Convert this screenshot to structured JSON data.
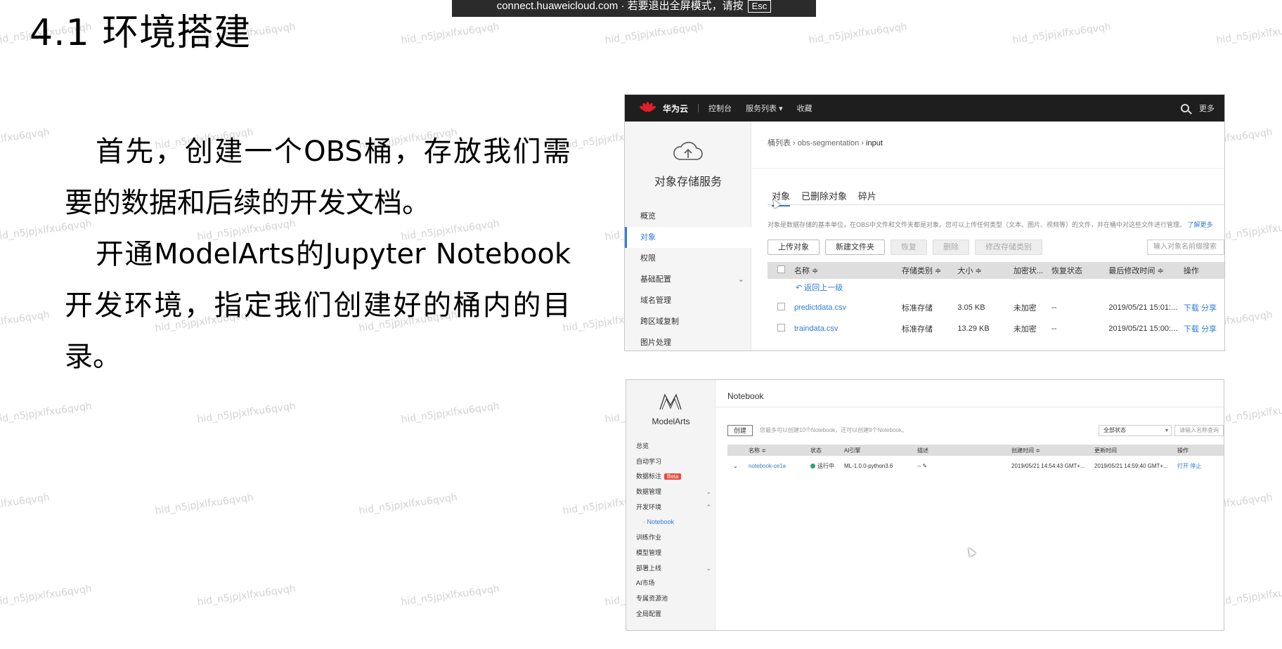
{
  "toast": {
    "text": "connect.huaweicloud.com · 若要退出全屏模式，请按",
    "key": "Esc"
  },
  "slide": {
    "title": "4.1 环境搭建",
    "paragraphs": [
      "首先，创建一个OBS桶，存放我们需要的数据和后续的开发文档。",
      "开通ModelArts的Jupyter Notebook开发环境，指定我们创建好的桶内的目录。"
    ]
  },
  "watermark": "hid_n5jpjxlfxu6qvqh",
  "obs": {
    "topbar": {
      "brand": "华为云",
      "nav": [
        "控制台",
        "服务列表 ▾",
        "收藏"
      ],
      "more": "更多"
    },
    "sidebar": {
      "service": "对象存储服务",
      "items": [
        {
          "label": "概览"
        },
        {
          "label": "对象",
          "active": true
        },
        {
          "label": "权限"
        },
        {
          "label": "基础配置",
          "chevron": "⌄"
        },
        {
          "label": "域名管理"
        },
        {
          "label": "跨区域复制"
        },
        {
          "label": "图片处理"
        }
      ]
    },
    "breadcrumb": {
      "root": "桶列表",
      "bucket": "obs-segmentation",
      "current": "input"
    },
    "tabs": [
      "对象",
      "已删除对象",
      "碎片"
    ],
    "hint": "对象是数据存储的基本单位，在OBS中文件和文件夹都是对象。您可以上传任何类型（文本、图片、视频等）的文件，并在桶中对这些文件进行管理。",
    "learn_more": "了解更多",
    "toolbar": [
      "上传对象",
      "新建文件夹",
      "恢复",
      "删除",
      "修改存储类别"
    ],
    "search_placeholder": "输入对象名前缀搜索",
    "columns": [
      "名称 ≑",
      "存储类别 ≑",
      "大小 ≑",
      "加密状...",
      "恢复状态",
      "最后修改时间 ≑",
      "操作"
    ],
    "back": "返回上一级",
    "rows": [
      {
        "name": "predictdata.csv",
        "class": "标准存储",
        "size": "3.05 KB",
        "enc": "未加密",
        "restore": "--",
        "time": "2019/05/21 15:01:...",
        "ops": "下载  分享"
      },
      {
        "name": "traindata.csv",
        "class": "标准存储",
        "size": "13.29 KB",
        "enc": "未加密",
        "restore": "--",
        "time": "2019/05/21 15:00:...",
        "ops": "下载  分享"
      }
    ]
  },
  "modelarts": {
    "brand": "ModelArts",
    "sidebar": [
      {
        "label": "总览"
      },
      {
        "label": "自动学习"
      },
      {
        "label": "数据标注",
        "badge": "Beta"
      },
      {
        "label": "数据管理",
        "chevron": "⌄"
      },
      {
        "label": "开发环境",
        "chevron": "⌃"
      },
      {
        "label": "· Notebook",
        "sub": true
      },
      {
        "label": "训练作业"
      },
      {
        "label": "模型管理"
      },
      {
        "label": "部署上线",
        "chevron": "⌄"
      },
      {
        "label": "AI市场"
      },
      {
        "label": "专属资源池"
      },
      {
        "label": "全局配置"
      }
    ],
    "title": "Notebook",
    "create": "创建",
    "info": "您最多可以创建10个Notebook，还可以创建9个Notebook。",
    "status_filter": "全部状态",
    "search_placeholder": "请输入名称查询",
    "columns": [
      "名称 ≑",
      "状态",
      "AI引擎",
      "描述",
      "创建时间 ≑",
      "更新时间",
      "操作"
    ],
    "rows": [
      {
        "name": "notebook-ce1a",
        "status": "运行中",
        "engine": "ML-1.0.0-python3.6",
        "desc": "-- ✎",
        "created": "2019/05/21 14:54:43 GMT+...",
        "updated": "2019/05/21 14:59:40 GMT+...",
        "ops": "打开  停止"
      }
    ]
  },
  "colors": {
    "accent": "#2f7dd8",
    "topbar": "#1e1e1e",
    "running": "#2ba471",
    "beta": "#e84c3d"
  }
}
